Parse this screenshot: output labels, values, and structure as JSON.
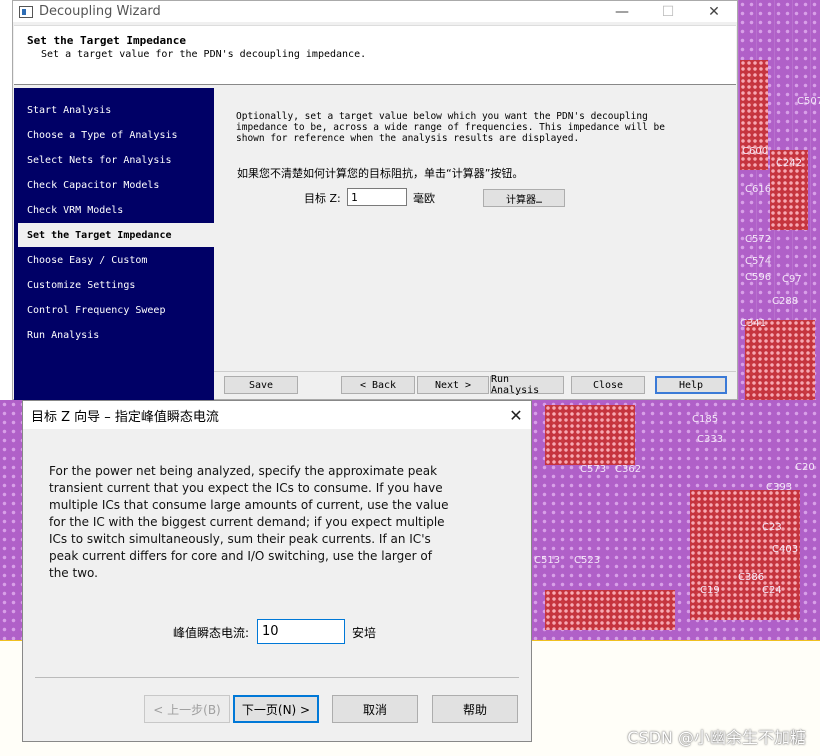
{
  "wizard": {
    "title": "Decoupling Wizard",
    "header_title": "Set the Target Impedance",
    "header_subtitle": "Set a target value for the PDN's decoupling impedance.",
    "steps": [
      {
        "label": "Start Analysis"
      },
      {
        "label": "Choose a Type of Analysis"
      },
      {
        "label": "Select Nets for Analysis"
      },
      {
        "label": "Check Capacitor Models"
      },
      {
        "label": "Check VRM Models"
      },
      {
        "label": "Set the Target Impedance",
        "active": true
      },
      {
        "label": "Choose Easy / Custom"
      },
      {
        "label": "Customize Settings"
      },
      {
        "label": "Control Frequency Sweep"
      },
      {
        "label": "Run Analysis"
      }
    ],
    "description_lines": [
      "Optionally, set a target value below which you want the PDN's decoupling",
      "impedance to be, across a wide range of frequencies. This impedance will be",
      "shown for reference when the analysis results are displayed."
    ],
    "hint": "如果您不清楚如何计算您的目标阻抗，单击“计算器”按钮。",
    "target_label": "目标 Z:",
    "target_value": "1",
    "target_unit": "毫欧",
    "calculator_button": "计算器…",
    "buttons": {
      "save": "Save",
      "back": "< Back",
      "next": "Next >",
      "run": "Run Analysis",
      "close": "Close",
      "help": "Help"
    }
  },
  "dialog": {
    "title": "目标 Z 向导 – 指定峰值瞬态电流",
    "description": "For the power net being analyzed, specify the approximate peak transient current that you expect the ICs to consume. If you have multiple ICs that consume large amounts of current, use the value for the IC with the biggest current demand; if you expect multiple ICs to switch simultaneously, sum their peak currents. If an IC's peak current differs for core and I/O switching, use the larger of the two.",
    "peak_label": "峰值瞬态电流:",
    "peak_value": "10",
    "peak_unit": "安培",
    "buttons": {
      "prev": "< 上一步(B)",
      "next": "下一页(N) >",
      "cancel": "取消",
      "help": "帮助"
    }
  },
  "background": {
    "labels": [
      "C507",
      "C600",
      "C242",
      "C616",
      "C572",
      "C574",
      "C596",
      "C97",
      "C288",
      "C185",
      "C393",
      "C23",
      "C403",
      "C386",
      "C24",
      "C19",
      "C573",
      "C362",
      "C523",
      "C513",
      "C20",
      "C333",
      "C341"
    ],
    "watermark": "CSDN @小幽余生不加糖"
  },
  "colors": {
    "steps_bg": "#000066",
    "pcb_purple": "#b060c8",
    "accent_blue": "#0078d7"
  }
}
